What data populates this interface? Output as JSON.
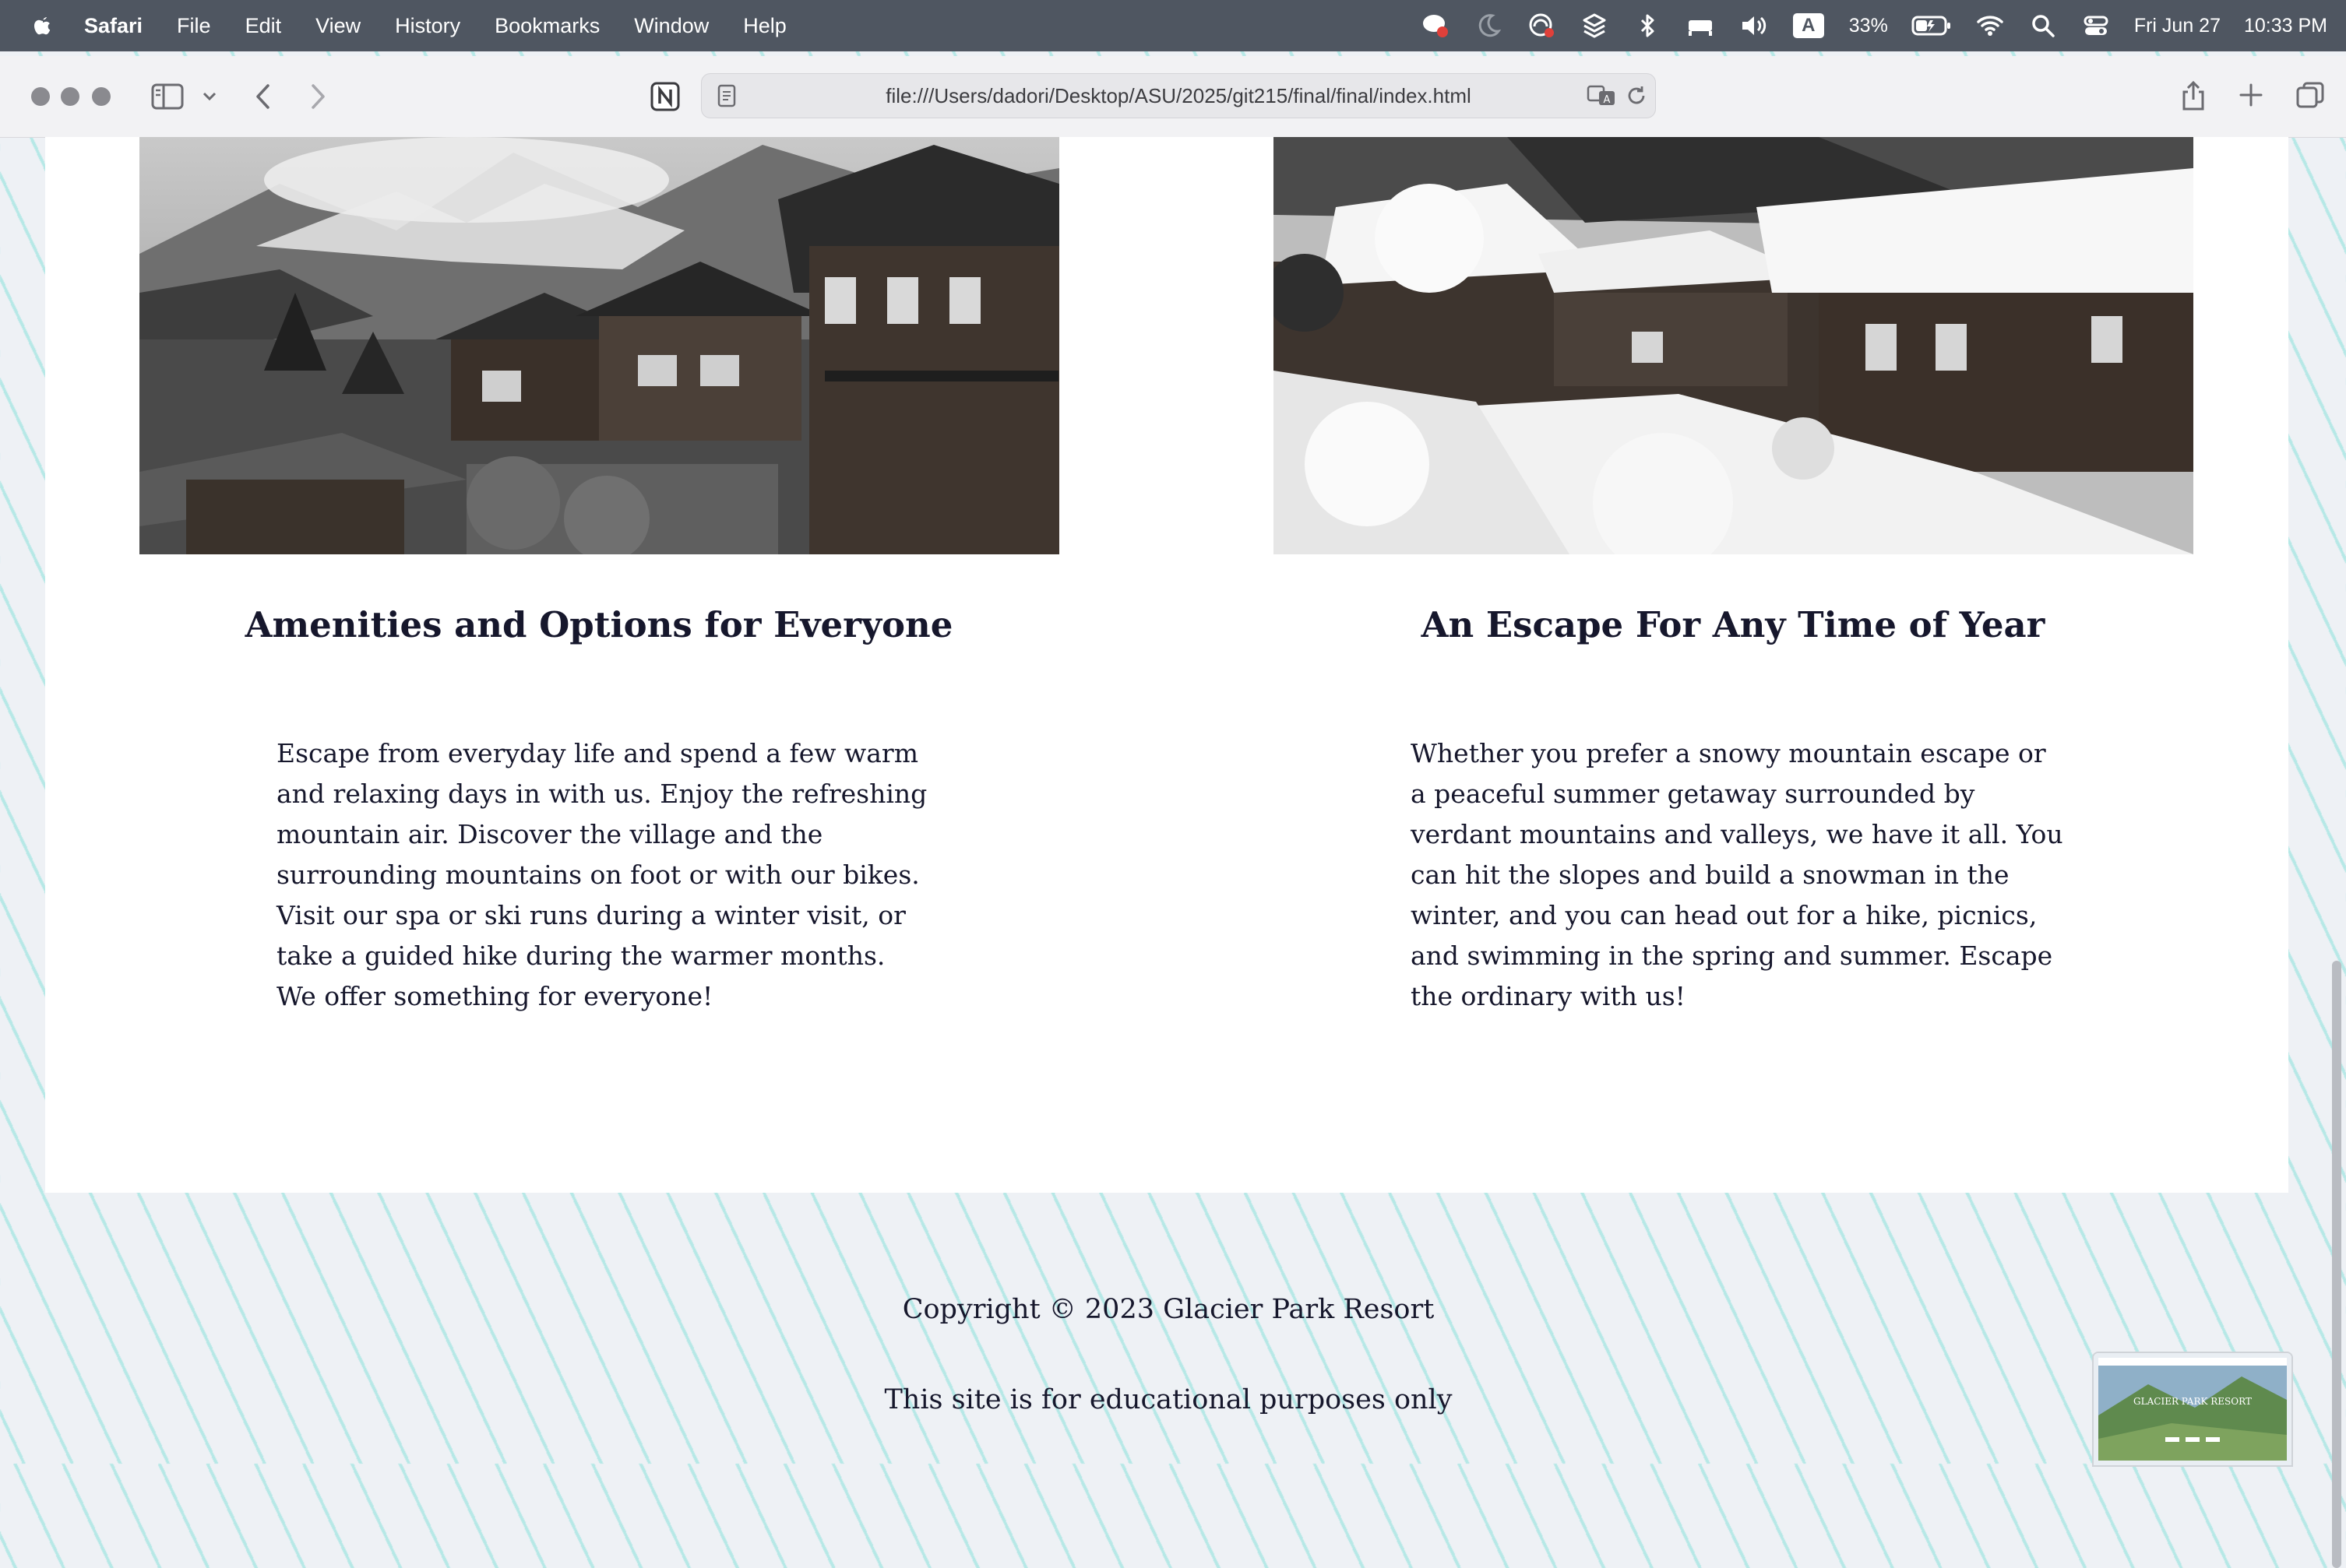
{
  "menubar": {
    "app_name": "Safari",
    "items": [
      "File",
      "Edit",
      "View",
      "History",
      "Bookmarks",
      "Window",
      "Help"
    ],
    "battery": "33%",
    "input_source": "A",
    "date": "Fri Jun 27",
    "time": "10:33 PM"
  },
  "browser": {
    "url": "file:///Users/dadori/Desktop/ASU/2025/git215/final/final/index.html"
  },
  "page": {
    "left": {
      "title": "Amenities and Options for Everyone",
      "text": "Escape from everyday life and spend a few warm and relaxing days in with us. Enjoy the refreshing mountain air. Discover the village and the surrounding mountains on foot or with our bikes. Visit our spa or ski runs during a winter visit, or take a guided hike during the warmer months. We offer something for everyone!"
    },
    "right": {
      "title": "An Escape For Any Time of Year",
      "text": "Whether you prefer a snowy mountain escape or a peaceful summer getaway surrounded by verdant mountains and valleys, we have it all. You can hit the slopes and build a snowman in the winter, and you can head out for a hike, picnics, and swimming in the spring and summer. Escape the ordinary with us!"
    },
    "footer": {
      "copyright": "Copyright © 2023 Glacier Park Resort",
      "disclaimer": "This site is for educational purposes only"
    }
  },
  "thumbnail": {
    "title": "GLACIER PARK RESORT"
  }
}
